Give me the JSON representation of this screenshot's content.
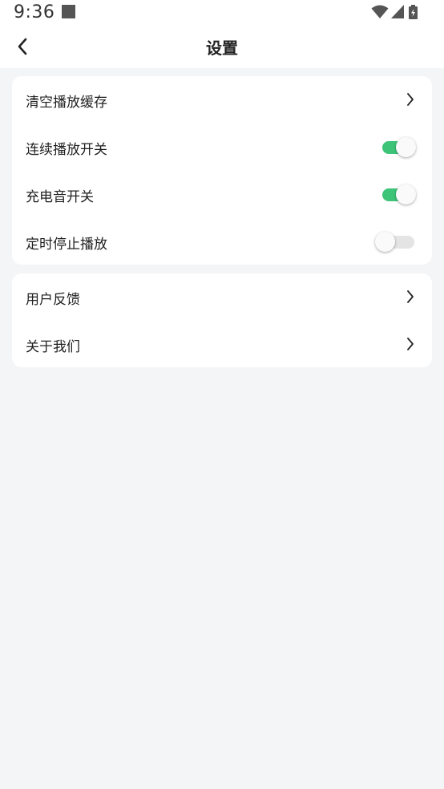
{
  "status_bar": {
    "time": "9:36",
    "icons": [
      "notification-square-icon",
      "wifi-icon",
      "cell-signal-icon",
      "battery-icon"
    ]
  },
  "header": {
    "title": "设置",
    "back_icon": "chevron-left-icon"
  },
  "settings_group_1": [
    {
      "label": "清空播放缓存",
      "control": "chevron"
    },
    {
      "label": "连续播放开关",
      "control": "toggle",
      "on": true
    },
    {
      "label": "充电音开关",
      "control": "toggle",
      "on": true
    },
    {
      "label": "定时停止播放",
      "control": "toggle",
      "on": false
    }
  ],
  "settings_group_2": [
    {
      "label": "用户反馈",
      "control": "chevron"
    },
    {
      "label": "关于我们",
      "control": "chevron"
    }
  ],
  "colors": {
    "toggle_on": "#3dc479",
    "toggle_off": "#e4e4e4",
    "background": "#f4f5f7",
    "card": "#ffffff"
  }
}
